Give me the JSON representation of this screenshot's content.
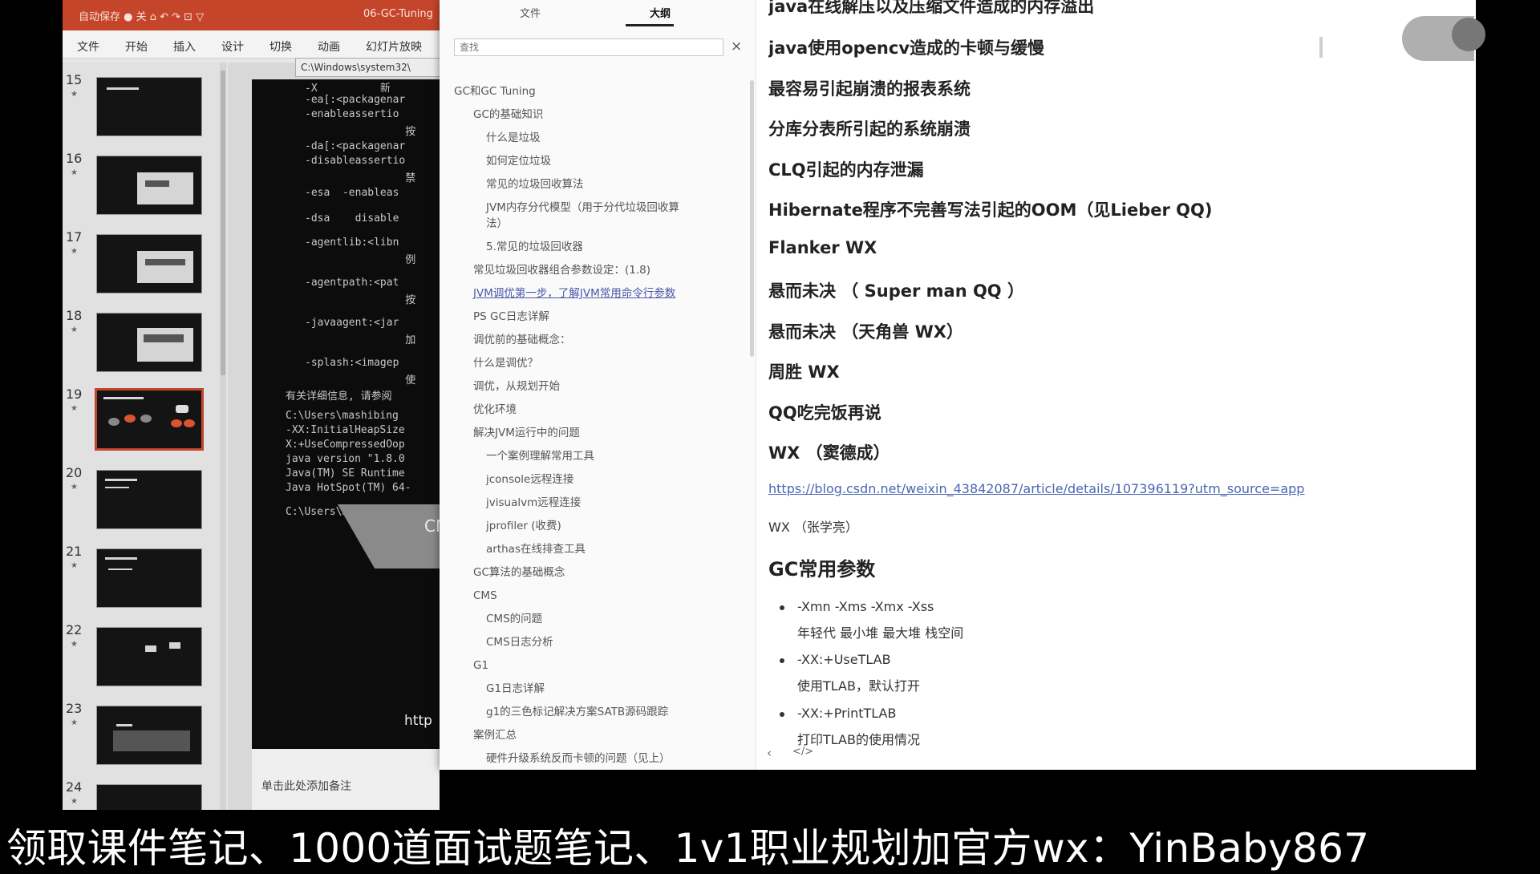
{
  "ppt": {
    "quick_access": "自动保存 ● 关 ⌂ ↶ ↷ ⊡ ▽",
    "doc_title": "06-GC-Tuning",
    "ribbon_tabs": [
      "文件",
      "开始",
      "插入",
      "设计",
      "切换",
      "动画",
      "幻灯片放映"
    ],
    "slides": [
      "15",
      "16",
      "17",
      "18",
      "19",
      "20",
      "21",
      "22",
      "23",
      "24"
    ],
    "selected_slide": "19",
    "cmd_tab": "C:\\Windows\\system32\\",
    "cmd_lines": [
      "-X          新",
      "-ea[:<packagenar",
      "-enableassertio",
      "                按",
      "-da[:<packagenar",
      "-disableassertio",
      "                禁",
      "-esa  -enableas",
      "-dsa    disable",
      "-agentlib:<libn",
      "                例",
      "-agentpath:<pat",
      "                按",
      "-javaagent:<jar",
      "                加",
      "-splash:<imagep",
      "                使",
      "有关详细信息, 请参阅",
      "C:\\Users\\mashibing",
      "-XX:InitialHeapSize",
      "X:+UseCompressedOop",
      "java version \"1.8.0",
      "Java(TM) SE Runtime",
      "Java HotSpot(TM) 64-",
      "C:\\Users\\mashibing>"
    ],
    "cmd_overlay_text": "CM",
    "cmd_url_text": "http",
    "notes_placeholder": "单击此处添加备注"
  },
  "sidebar": {
    "tabs": [
      "文件",
      "大纲"
    ],
    "active_tab": "大纲",
    "search_placeholder": "查找",
    "close_icon": "×",
    "outline": [
      {
        "text": "GC和GC Tuning",
        "level": 0
      },
      {
        "text": "GC的基础知识",
        "level": 1
      },
      {
        "text": "什么是垃圾",
        "level": 2
      },
      {
        "text": "如何定位垃圾",
        "level": 2
      },
      {
        "text": "常见的垃圾回收算法",
        "level": 2
      },
      {
        "text": "JVM内存分代模型（用于分代垃圾回收算",
        "level": 2
      },
      {
        "text": "法）",
        "level": 2,
        "cont": true
      },
      {
        "text": "5.常见的垃圾回收器",
        "level": 2
      },
      {
        "text": "常见垃圾回收器组合参数设定：(1.8)",
        "level": 1
      },
      {
        "text": "JVM调优第一步，了解JVM常用命令行参数",
        "level": 1,
        "highlight": true
      },
      {
        "text": "PS GC日志详解",
        "level": 1
      },
      {
        "text": "调优前的基础概念：",
        "level": 1
      },
      {
        "text": "什么是调优？",
        "level": 1
      },
      {
        "text": "调优，从规划开始",
        "level": 1
      },
      {
        "text": "优化环境",
        "level": 1
      },
      {
        "text": "解决JVM运行中的问题",
        "level": 1
      },
      {
        "text": "一个案例理解常用工具",
        "level": 2
      },
      {
        "text": "jconsole远程连接",
        "level": 2
      },
      {
        "text": "jvisualvm远程连接",
        "level": 2
      },
      {
        "text": "jprofiler (收费)",
        "level": 2
      },
      {
        "text": "arthas在线排查工具",
        "level": 2
      },
      {
        "text": "GC算法的基础概念",
        "level": 1
      },
      {
        "text": "CMS",
        "level": 1
      },
      {
        "text": "CMS的问题",
        "level": 2
      },
      {
        "text": "CMS日志分析",
        "level": 2
      },
      {
        "text": "G1",
        "level": 1
      },
      {
        "text": "G1日志详解",
        "level": 2
      },
      {
        "text": "g1的三色标记解决方案SATB源码跟踪",
        "level": 2
      },
      {
        "text": "案例汇总",
        "level": 1
      },
      {
        "text": "硬件升级系统反而卡顿的问题（见上）",
        "level": 2
      }
    ],
    "footer_prev": "‹",
    "footer_code": "</>"
  },
  "content": {
    "headings": [
      "java在线解压以及压缩文件造成的内存溢出",
      "java使用opencv造成的卡顿与缓慢",
      "最容易引起崩溃的报表系统",
      "分库分表所引起的系统崩溃",
      "CLQ引起的内存泄漏",
      "Hibernate程序不完善写法引起的OOM（见Lieber QQ)",
      "Flanker WX",
      "悬而未决 （ Super man QQ ）",
      "悬而未决 （天角兽 WX）",
      "周胜 WX",
      "QQ吃完饭再说",
      "WX （窦德成）"
    ],
    "link": "https://blog.csdn.net/weixin_43842087/article/details/107396119?utm_source=app",
    "wx_line": "WX （张学亮）",
    "section_title": "GC常用参数",
    "bullets": [
      {
        "line1": "-Xmn -Xms -Xmx -Xss",
        "line2": "年轻代 最小堆 最大堆 栈空间"
      },
      {
        "line1": "-XX:+UseTLAB",
        "line2": "使用TLAB，默认打开"
      },
      {
        "line1": "-XX:+PrintTLAB",
        "line2": "打印TLAB的使用情况"
      }
    ]
  },
  "banner": "领取课件笔记、1000道面试题笔记、1v1职业规划加官方wx：YinBaby867"
}
